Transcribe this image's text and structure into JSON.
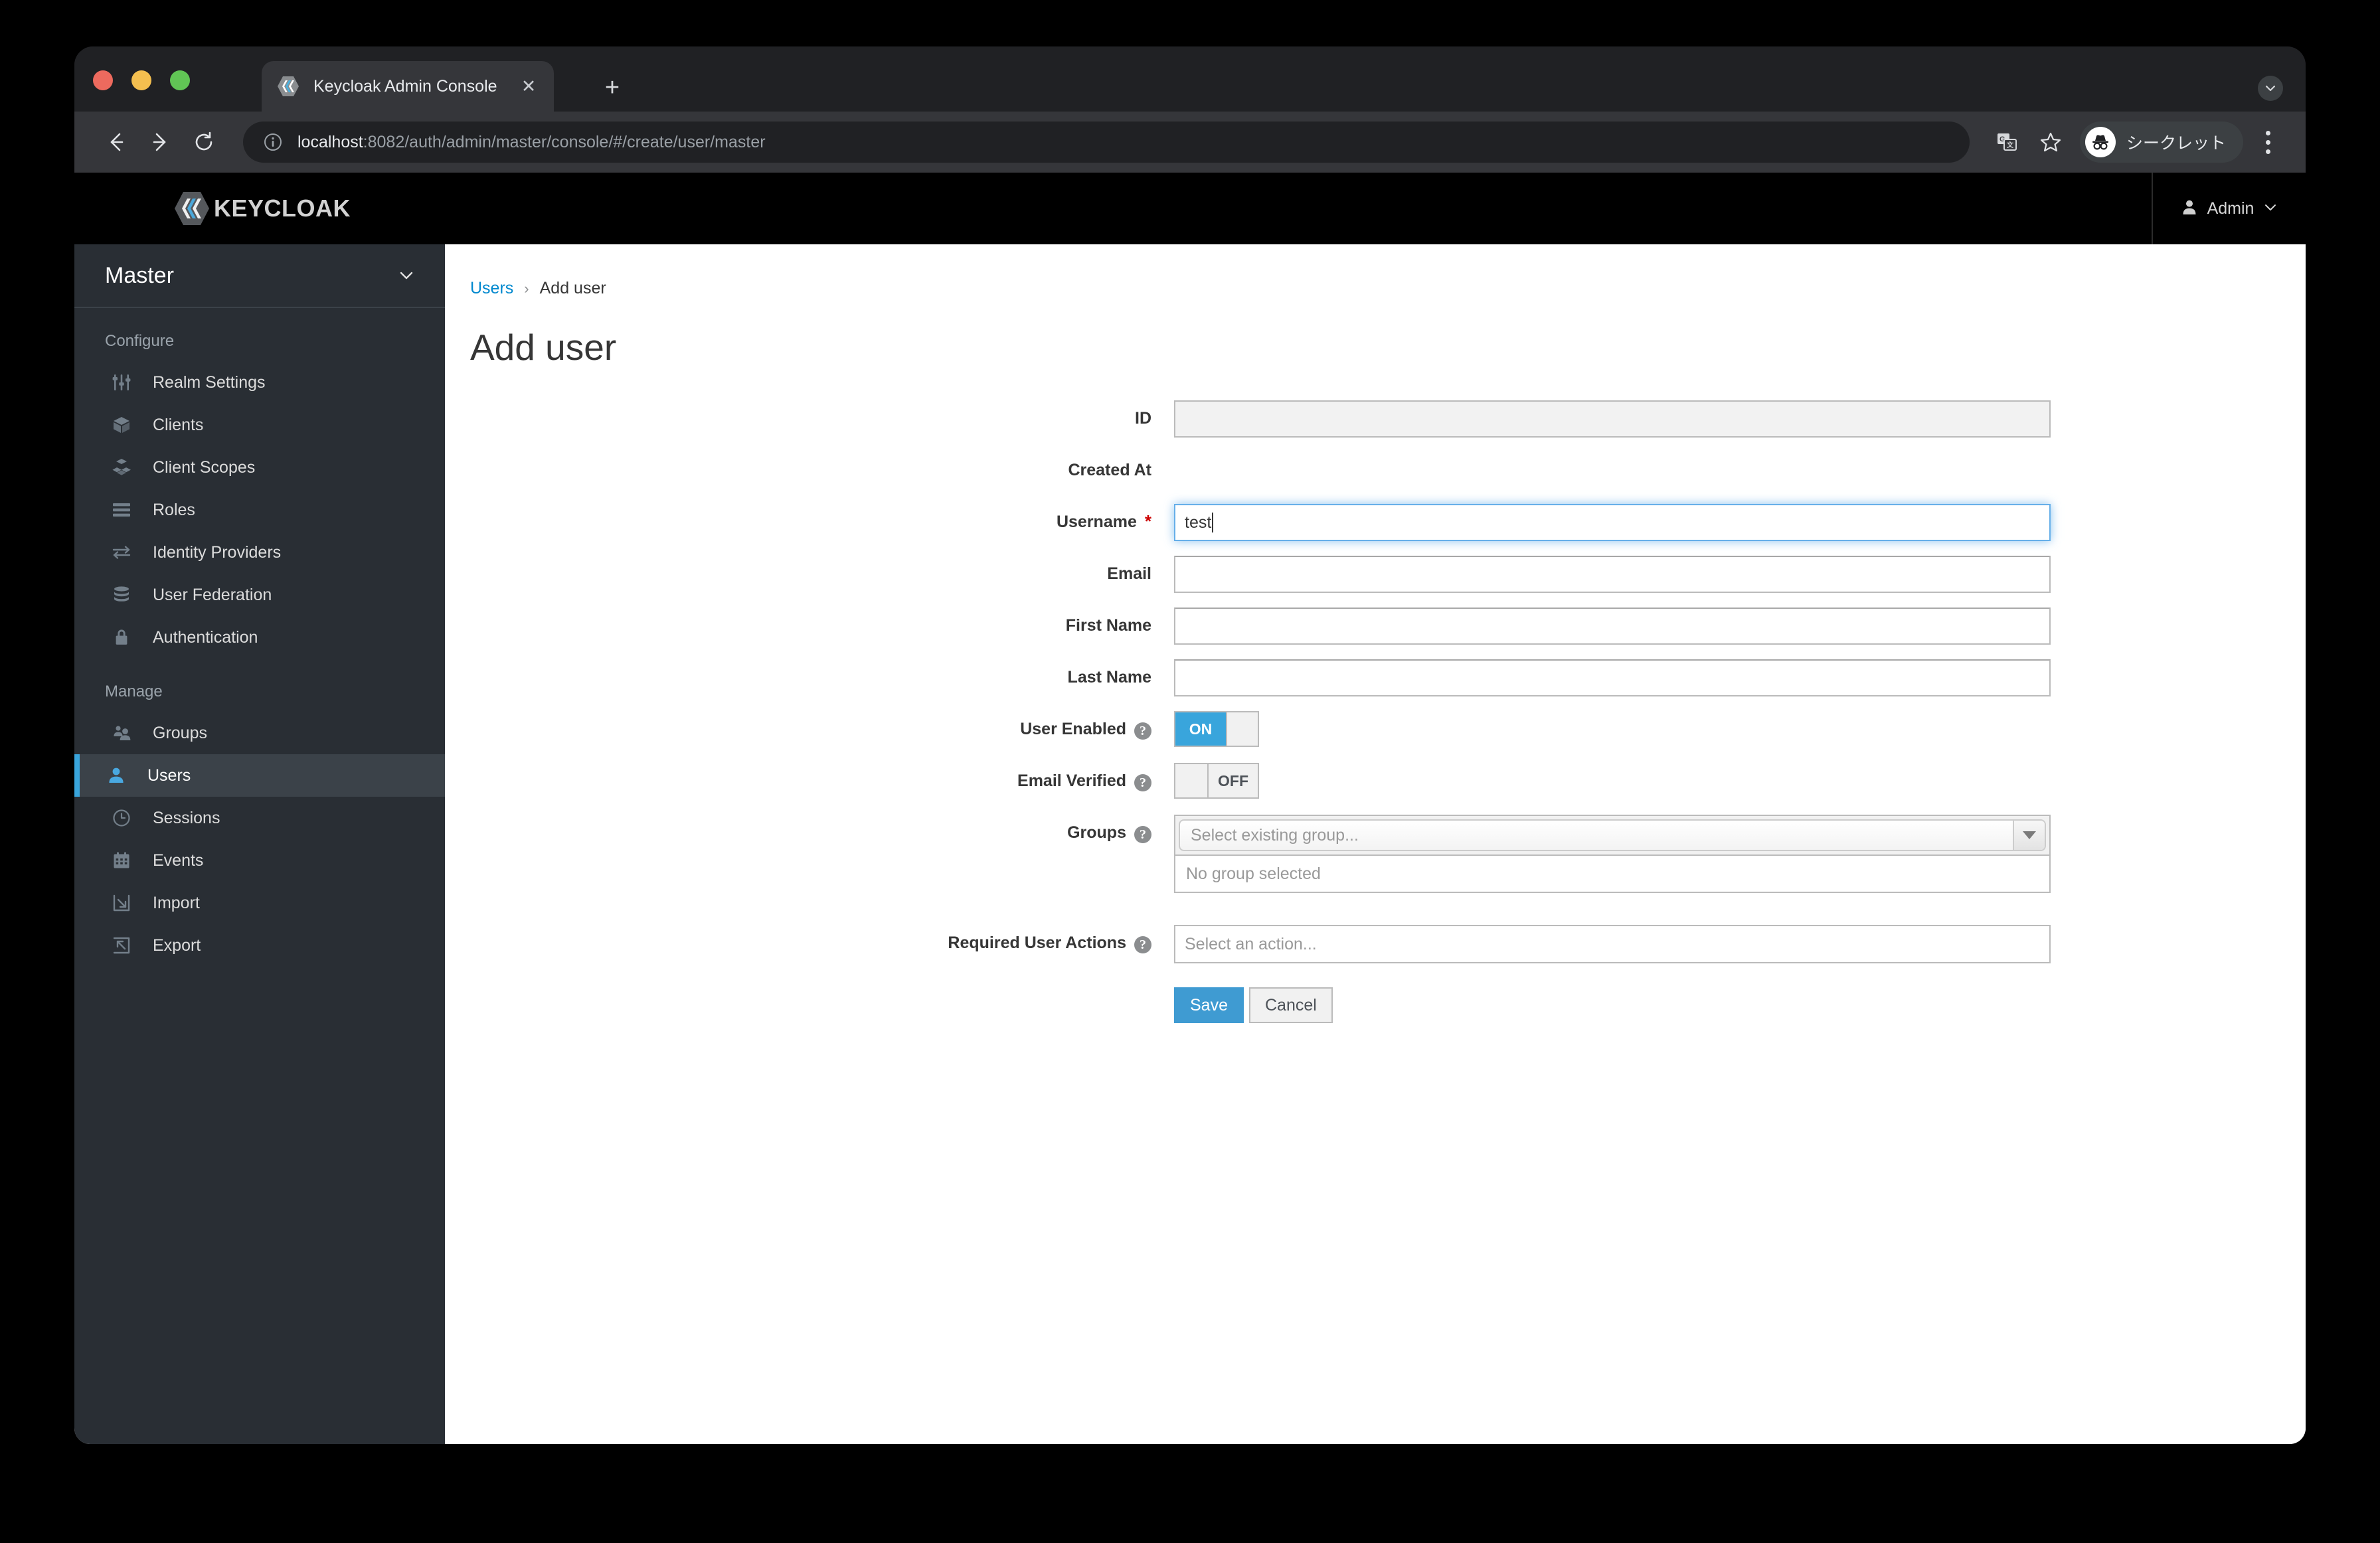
{
  "browser": {
    "tab": {
      "title": "Keycloak Admin Console",
      "favicon": "keycloak-icon",
      "close_label": "✕"
    },
    "new_tab_label": "+",
    "nav": {
      "back": "back-icon",
      "forward": "forward-icon",
      "reload": "reload-icon"
    },
    "omnibox": {
      "info_icon": "info-icon",
      "url_host": "localhost",
      "url_rest": ":8082/auth/admin/master/console/#/create/user/master"
    },
    "toolbar": {
      "translate_icon": "translate-icon",
      "bookmark_icon": "star-icon",
      "incognito_label": "シークレット",
      "menu_icon": "kebab-menu-icon"
    }
  },
  "masthead": {
    "brand": "KEYCLOAK",
    "user_label": "Admin"
  },
  "sidebar": {
    "realm": "Master",
    "sections": [
      {
        "title": "Configure",
        "items": [
          {
            "label": "Realm Settings",
            "icon": "sliders-icon",
            "active": false
          },
          {
            "label": "Clients",
            "icon": "box-icon",
            "active": false
          },
          {
            "label": "Client Scopes",
            "icon": "boxes-icon",
            "active": false
          },
          {
            "label": "Roles",
            "icon": "list-icon",
            "active": false
          },
          {
            "label": "Identity Providers",
            "icon": "exchange-icon",
            "active": false
          },
          {
            "label": "User Federation",
            "icon": "database-icon",
            "active": false
          },
          {
            "label": "Authentication",
            "icon": "lock-icon",
            "active": false
          }
        ]
      },
      {
        "title": "Manage",
        "items": [
          {
            "label": "Groups",
            "icon": "users-icon",
            "active": false
          },
          {
            "label": "Users",
            "icon": "user-icon",
            "active": true
          },
          {
            "label": "Sessions",
            "icon": "clock-icon",
            "active": false
          },
          {
            "label": "Events",
            "icon": "calendar-icon",
            "active": false
          },
          {
            "label": "Import",
            "icon": "import-icon",
            "active": false
          },
          {
            "label": "Export",
            "icon": "export-icon",
            "active": false
          }
        ]
      }
    ]
  },
  "content": {
    "breadcrumb": {
      "parent": "Users",
      "separator": "›",
      "current": "Add user"
    },
    "title": "Add user",
    "form": {
      "id": {
        "label": "ID",
        "value": ""
      },
      "created_at": {
        "label": "Created At",
        "value": ""
      },
      "username": {
        "label": "Username",
        "value": "test",
        "required_marker": "*"
      },
      "email": {
        "label": "Email",
        "value": ""
      },
      "first_name": {
        "label": "First Name",
        "value": ""
      },
      "last_name": {
        "label": "Last Name",
        "value": ""
      },
      "user_enabled": {
        "label": "User Enabled",
        "state": "ON",
        "help": "?"
      },
      "email_verified": {
        "label": "Email Verified",
        "state": "OFF",
        "help": "?"
      },
      "groups": {
        "label": "Groups",
        "help": "?",
        "placeholder": "Select existing group...",
        "empty_text": "No group selected"
      },
      "required_user_actions": {
        "label": "Required User Actions",
        "help": "?",
        "placeholder": "Select an action..."
      },
      "save_label": "Save",
      "cancel_label": "Cancel"
    }
  },
  "colors": {
    "accent_blue": "#39a5dc",
    "link_blue": "#0088ce",
    "required_red": "#cc0000",
    "sidebar_bg": "#292e34"
  }
}
